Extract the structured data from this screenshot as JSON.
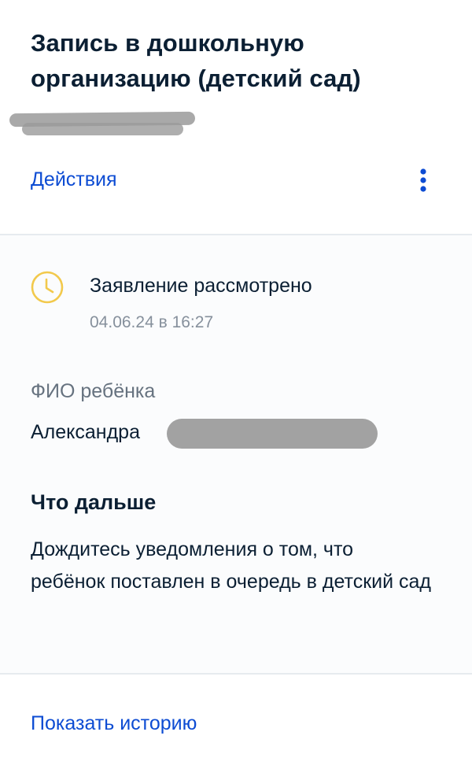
{
  "header": {
    "title": "Запись в дошкольную организацию (детский сад)",
    "actions_label": "Действия",
    "menu_icon": "more-vertical-icon"
  },
  "status": {
    "icon": "clock-icon",
    "icon_color": "#f2c94c",
    "title": "Заявление рассмотрено",
    "date": "04.06.24 в 16:27"
  },
  "child": {
    "label": "ФИО ребёнка",
    "name": "Александра"
  },
  "next_steps": {
    "title": "Что дальше",
    "text": "Дождитесь уведомления о том, что ребёнок поставлен в очередь в детский сад"
  },
  "footer": {
    "history_label": "Показать историю"
  },
  "colors": {
    "link": "#0d4cd3",
    "text": "#0b1f33",
    "muted": "#86909c",
    "divider": "#e6ebef"
  }
}
